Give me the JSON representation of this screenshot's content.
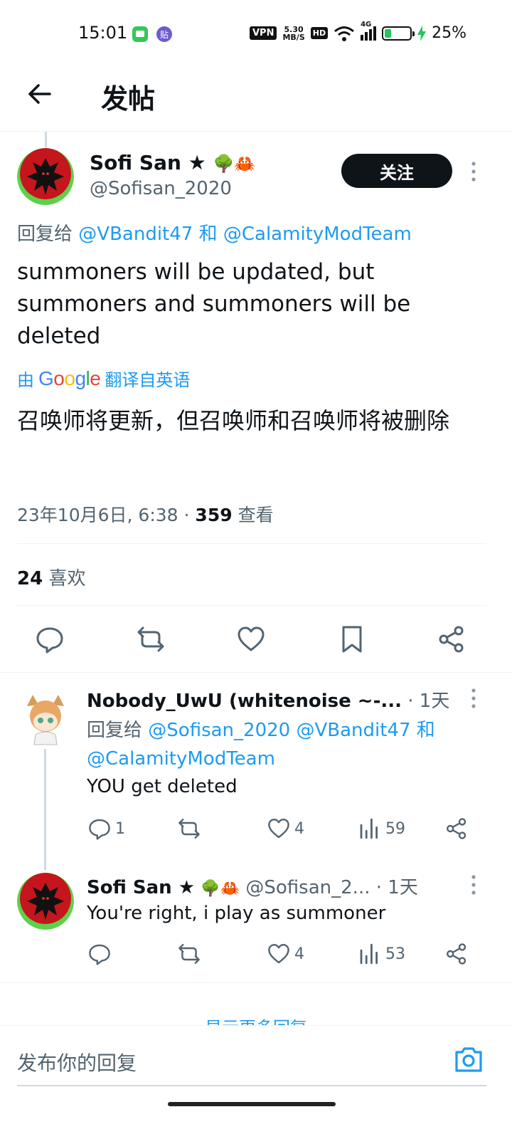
{
  "status_bar": {
    "time": "15:01",
    "vpn": "VPN",
    "net_speed_value": "5.30",
    "net_speed_unit": "MB/S",
    "hd": "HD",
    "signal": "4G",
    "battery_percent": "25%",
    "battery_level": 0.25,
    "battery_color": "#22c55e"
  },
  "header": {
    "title": "发帖"
  },
  "main_tweet": {
    "author_name": "Sofi San ★",
    "author_emojis": "🌳🦀",
    "author_handle": "@Sofisan_2020",
    "follow_label": "关注",
    "reply_prefix": "回复给",
    "reply_user_1": "@VBandit47",
    "reply_conjunction": "和",
    "reply_user_2": "@CalamityModTeam",
    "text": "summoners will be updated, but summoners and summoners will be deleted",
    "translate_prefix": "由",
    "translate_brand": "Google",
    "translate_suffix": "翻译自英语",
    "translated_text": "召唤师将更新，但召唤师和召唤师将被删除",
    "timestamp": "23年10月6日, 6:38 ·",
    "views_count": "359",
    "views_label": "查看",
    "likes_count": "24",
    "likes_label": "喜欢"
  },
  "replies": [
    {
      "author_name": "Nobody_UwU (whitenoise ~-...",
      "time": "· 1天",
      "reply_prefix": "回复给",
      "reply_users": "@Sofisan_2020 @VBandit47",
      "reply_conjunction": "和",
      "reply_user_last": "@CalamityModTeam",
      "text": "YOU get deleted",
      "reply_count": "1",
      "like_count": "4",
      "view_count": "59"
    },
    {
      "author_name": "Sofi San ★",
      "author_emojis": "🌳🦀",
      "author_handle": "@Sofisan_2...",
      "time": "· 1天",
      "text": "You're right, i play as summoner",
      "like_count": "4",
      "view_count": "53"
    }
  ],
  "show_more": "显示更多回复",
  "compose": {
    "placeholder": "发布你的回复"
  },
  "colors": {
    "accent": "#1d9bf0",
    "text": "#0f1419",
    "muted": "#536471",
    "divider": "#eff3f4"
  }
}
